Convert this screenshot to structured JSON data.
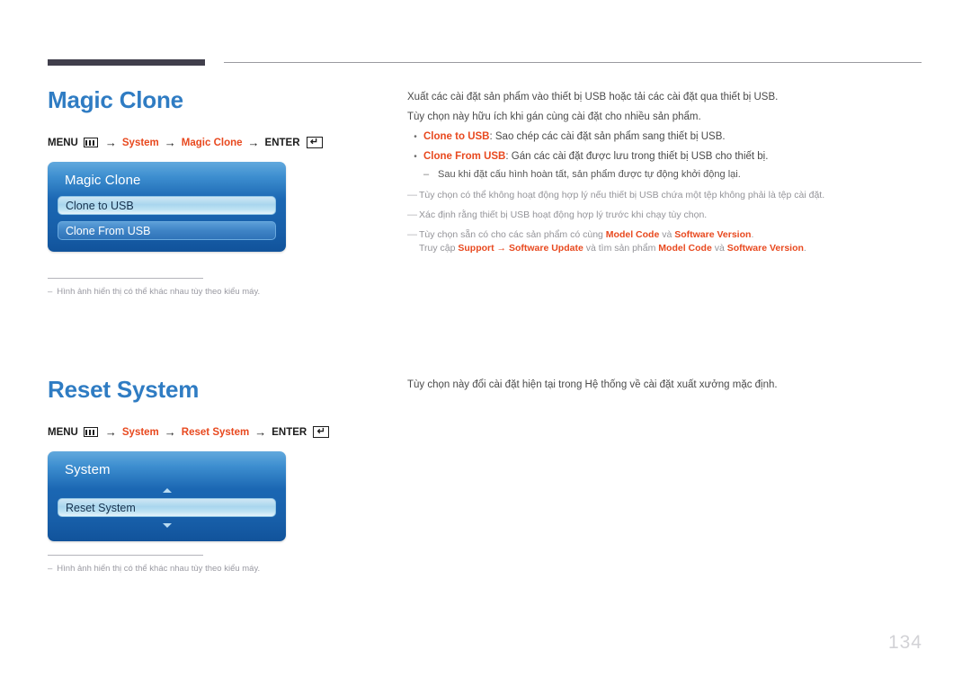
{
  "page": {
    "number": "134"
  },
  "sections": [
    {
      "heading": "Magic Clone",
      "menu_path": {
        "menu_label": "MENU",
        "menu_icon": "menu-grid-icon",
        "arrow": "→",
        "step1": "System",
        "step2": "Magic Clone",
        "enter_label": "ENTER",
        "enter_icon": "↵"
      },
      "osd": {
        "title": "Magic Clone",
        "rows": [
          {
            "label": "Clone to USB",
            "selected": true
          },
          {
            "label": "Clone From USB",
            "selected": false
          }
        ],
        "has_scroll_arrows": false
      },
      "caption": {
        "dash": "–",
        "text": "Hình ảnh hiển thị có thể khác nhau tùy theo kiểu máy."
      }
    },
    {
      "heading": "Reset System",
      "menu_path": {
        "menu_label": "MENU",
        "menu_icon": "menu-grid-icon",
        "arrow": "→",
        "step1": "System",
        "step2": "Reset System",
        "enter_label": "ENTER",
        "enter_icon": "↵"
      },
      "osd": {
        "title": "System",
        "rows": [
          {
            "label": "Reset System",
            "selected": true
          }
        ],
        "has_scroll_arrows": true
      },
      "caption": {
        "dash": "–",
        "text": "Hình ảnh hiển thị có thể khác nhau tùy theo kiểu máy."
      }
    }
  ],
  "magic_clone_body": {
    "intro1": "Xuất các cài đặt sản phẩm vào thiết bị USB hoặc tải các cài đặt qua thiết bị USB.",
    "intro2": "Tùy chọn này hữu ích khi gán cùng cài đặt cho nhiều sản phẩm.",
    "bullet1": {
      "mark": "•",
      "term": "Clone to USB",
      "rest": ": Sao chép các cài đặt sản phẩm sang thiết bị USB."
    },
    "bullet2": {
      "mark": "•",
      "term": "Clone From USB",
      "rest": ": Gán các cài đặt được lưu trong thiết bị USB cho thiết bị."
    },
    "subdash": {
      "mark": "–",
      "text": "Sau khi đặt cấu hình hoàn tất, sản phẩm được tự động khởi động lại."
    },
    "note1": {
      "mark": "—",
      "text": "Tùy chọn có thể không hoạt động hợp lý nếu thiết bị USB chứa một tệp không phải là tệp cài đặt."
    },
    "note2": {
      "mark": "—",
      "text": "Xác định rằng thiết bị USB hoạt động hợp lý trước khi chạy tùy chọn."
    },
    "note3": {
      "mark": "—",
      "prefix": "Tùy chọn sẵn có cho các sản phẩm có cùng ",
      "bold1": "Model Code",
      "mid": " và ",
      "bold2": "Software Version",
      "suffix": "."
    },
    "note3_sub": {
      "prefix": "Truy cập ",
      "bold1": "Support",
      "arrow": " → ",
      "bold2": "Software Update",
      "mid": " và tìm sản phẩm ",
      "bold3": "Model Code",
      "mid2": " và ",
      "bold4": "Software Version",
      "suffix": "."
    }
  },
  "reset_system_body": {
    "intro1": "Tùy chọn này đổi cài đặt hiện tại trong Hệ thống về cài đặt xuất xưởng mặc định."
  },
  "colors": {
    "heading_blue": "#2f7cc3",
    "accent_orange": "#e8491f",
    "rule_dark": "#413f4c",
    "note_gray": "#949499",
    "page_number_gray": "#d2d2d6"
  }
}
